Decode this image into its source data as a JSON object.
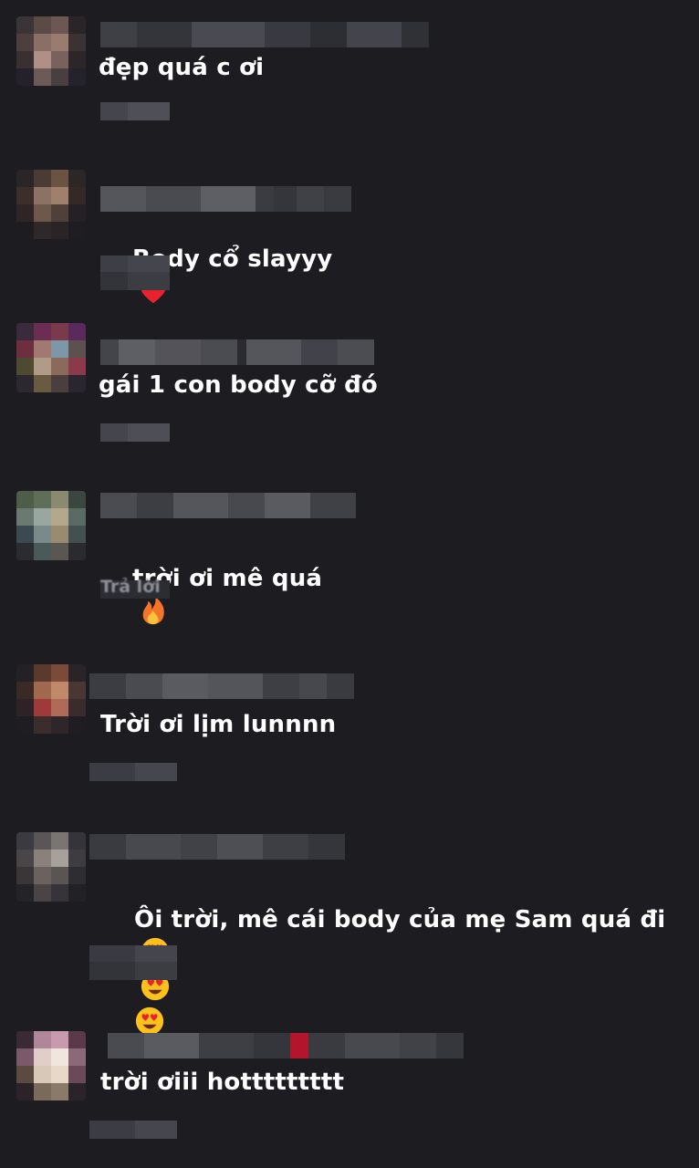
{
  "comments": [
    {
      "text": "đẹp quá c ơi",
      "emoji": []
    },
    {
      "text": "Body cổ slayyy",
      "emoji": [
        "red-heart"
      ]
    },
    {
      "text": "gái 1 con body cỡ đó",
      "emoji": []
    },
    {
      "text": "trời ơi mê quá",
      "emoji": [
        "fire"
      ]
    },
    {
      "text": "Trời ơi lịm lunnnn",
      "emoji": []
    },
    {
      "text": "Ôi trời, mê cái body của mẹ Sam quá đi",
      "emoji": [
        "heart-eyes",
        "heart-eyes",
        "heart-eyes"
      ]
    },
    {
      "text": "trời ơiii hottttttttt",
      "emoji": []
    }
  ],
  "reply_label": "Trả lời",
  "colors": {
    "background": "#1d1d21",
    "text": "#ffffff",
    "secondary": "#8e8f97"
  }
}
